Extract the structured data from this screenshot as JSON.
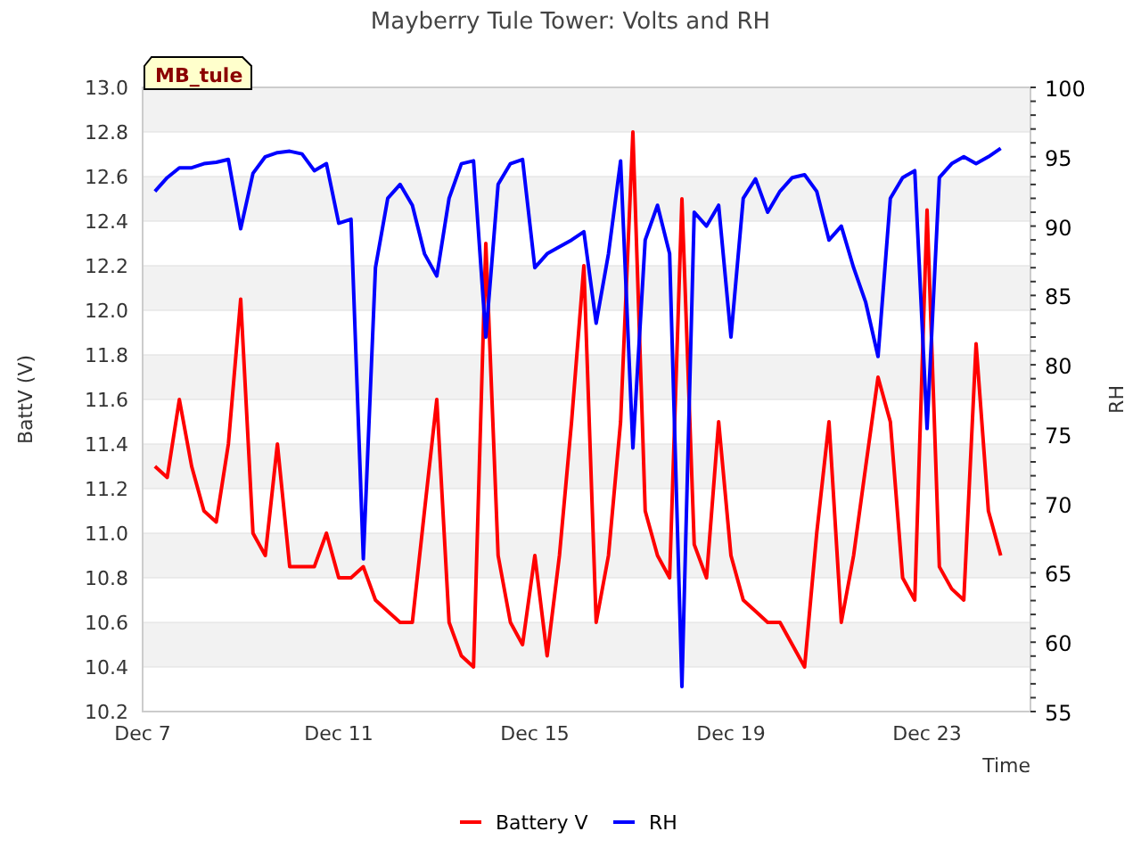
{
  "badge": "MB_tule",
  "chart_data": {
    "type": "line",
    "title": "Mayberry Tule Tower: Volts and RH",
    "xlabel": "Time",
    "ylabel": "BattV (V)",
    "y2label": "RH",
    "grid": true,
    "legend": "bottom",
    "ylim": [
      10.2,
      13.0
    ],
    "y2lim": [
      55,
      100
    ],
    "categories": [
      "Dec 7",
      null,
      null,
      null,
      null,
      null,
      null,
      null,
      null,
      null,
      null,
      null,
      null,
      null,
      null,
      null,
      "Dec 11",
      null,
      null,
      null,
      null,
      null,
      null,
      null,
      null,
      null,
      null,
      null,
      null,
      null,
      null,
      null,
      "Dec 15",
      null,
      null,
      null,
      null,
      null,
      null,
      null,
      null,
      null,
      null,
      null,
      null,
      null,
      null,
      null,
      "Dec 19",
      null,
      null,
      null,
      null,
      null,
      null,
      null,
      null,
      null,
      null,
      null,
      null,
      null,
      null,
      null,
      "Dec 23",
      null,
      null,
      null,
      null,
      null,
      null,
      null,
      null
    ],
    "yticks": [
      {
        "value": 10.2,
        "label": "10.2"
      },
      {
        "value": 10.4,
        "label": "10.4"
      },
      {
        "value": 10.6,
        "label": "10.6"
      },
      {
        "value": 10.8,
        "label": "10.8"
      },
      {
        "value": 11.0,
        "label": "11.0"
      },
      {
        "value": 11.2,
        "label": "11.2"
      },
      {
        "value": 11.4,
        "label": "11.4"
      },
      {
        "value": 11.6,
        "label": "11.6"
      },
      {
        "value": 11.8,
        "label": "11.8"
      },
      {
        "value": 12.0,
        "label": "12.0"
      },
      {
        "value": 12.2,
        "label": "12.2"
      },
      {
        "value": 12.4,
        "label": "12.4"
      },
      {
        "value": 12.6,
        "label": "12.6"
      },
      {
        "value": 12.8,
        "label": "12.8"
      },
      {
        "value": 13.0,
        "label": "13.0"
      }
    ],
    "y2ticks": [
      55,
      60,
      65,
      70,
      75,
      80,
      85,
      90,
      95,
      100
    ],
    "series": [
      {
        "name": "Battery V",
        "color": "#ff0000",
        "values": [
          null,
          11.3,
          11.25,
          11.6,
          11.3,
          11.1,
          11.05,
          11.4,
          12.05,
          11.0,
          10.9,
          11.4,
          10.85,
          10.85,
          10.85,
          11.0,
          10.8,
          10.8,
          10.85,
          10.7,
          10.65,
          10.6,
          10.6,
          11.1,
          11.6,
          10.6,
          10.45,
          10.4,
          12.3,
          10.9,
          10.6,
          10.5,
          10.9,
          10.45,
          10.9,
          11.5,
          12.2,
          10.6,
          10.9,
          11.5,
          12.8,
          11.1,
          10.9,
          10.8,
          12.5,
          10.95,
          10.8,
          11.5,
          10.9,
          10.7,
          10.65,
          10.6,
          10.6,
          10.5,
          10.4,
          11.0,
          11.5,
          10.6,
          10.9,
          11.3,
          11.7,
          11.5,
          10.8,
          10.7,
          12.45,
          10.85,
          10.75,
          10.7,
          11.85,
          11.1,
          10.9,
          null,
          null
        ]
      },
      {
        "name": "RH",
        "color": "#0000ff",
        "axis": "y2",
        "values": [
          null,
          92.5,
          93.5,
          94.2,
          94.2,
          94.5,
          94.6,
          94.8,
          89.8,
          93.8,
          95,
          95.3,
          95.4,
          95.2,
          94,
          94.5,
          90.2,
          90.5,
          66,
          87,
          92,
          93,
          91.5,
          88,
          86.4,
          92,
          94.5,
          94.7,
          82,
          93,
          94.5,
          94.8,
          87,
          88,
          88.5,
          89,
          89.6,
          83,
          88,
          94.7,
          74,
          89,
          91.5,
          88,
          56.8,
          91,
          90,
          91.5,
          82,
          92,
          93.4,
          91,
          92.5,
          93.5,
          93.7,
          92.5,
          89,
          90,
          87,
          84.5,
          80.6,
          92,
          93.5,
          94,
          75.4,
          93.5,
          94.5,
          95,
          94.5,
          95,
          95.6,
          null,
          null
        ]
      }
    ]
  }
}
